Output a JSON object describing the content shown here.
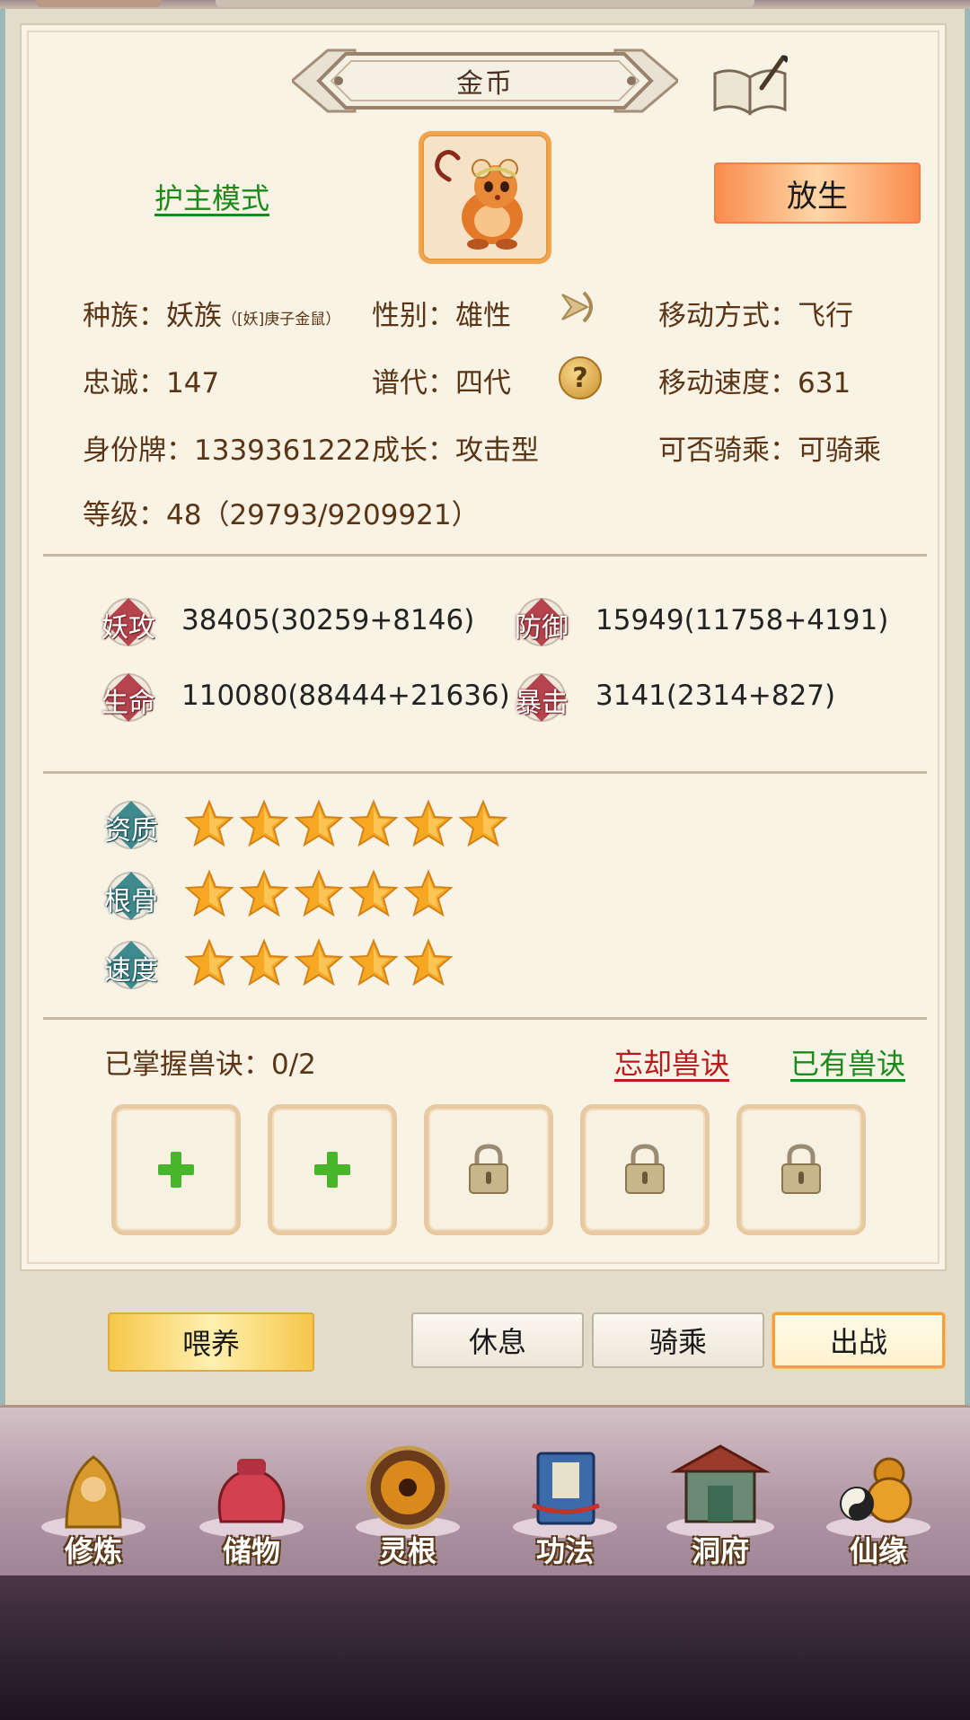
{
  "header": {
    "title": "金币"
  },
  "pet": {
    "guard_mode_label": "护主模式",
    "release_label": "放生",
    "race_label": "种族：",
    "race_value": "妖族",
    "race_detail": "（[妖]庚子金鼠）",
    "gender_label": "性别：",
    "gender_value": "雄性",
    "move_mode_label": "移动方式：",
    "move_mode_value": "飞行",
    "loyalty_label": "忠诚：",
    "loyalty_value": "147",
    "generation_label": "谱代：",
    "generation_value": "四代",
    "move_speed_label": "移动速度：",
    "move_speed_value": "631",
    "id_label": "身份牌：",
    "id_value": "1339361222",
    "growth_label": "成长：",
    "growth_value": "攻击型",
    "ride_label": "可否骑乘：",
    "ride_value": "可骑乘",
    "level_label": "等级：",
    "level_value": "48（29793/9209921）"
  },
  "stats": {
    "attack": {
      "label": "妖攻",
      "value": "38405(30259+8146)"
    },
    "defense": {
      "label": "防御",
      "value": "15949(11758+4191)"
    },
    "hp": {
      "label": "生命",
      "value": "110080(88444+21636)"
    },
    "crit": {
      "label": "暴击",
      "value": "3141(2314+827)"
    }
  },
  "aptitude": {
    "talent": {
      "label": "资质",
      "stars": 6
    },
    "bone": {
      "label": "根骨",
      "stars": 5
    },
    "speed": {
      "label": "速度",
      "stars": 5
    }
  },
  "skills": {
    "count_label": "已掌握兽诀：0/2",
    "forget_label": "忘却兽诀",
    "owned_label": "已有兽诀"
  },
  "actions": {
    "feed": "喂养",
    "rest": "休息",
    "ride": "骑乘",
    "battle": "出战"
  },
  "nav": {
    "cultivate": "修炼",
    "storage": "储物",
    "spirit_root": "灵根",
    "techniques": "功法",
    "cave": "洞府",
    "fate": "仙缘"
  },
  "colors": {
    "link_green": "#1a8a1a",
    "link_red": "#b71c1c",
    "stat_red": "#b5444f",
    "apt_teal": "#3f8a8e",
    "star_gold": "#f7a823"
  }
}
